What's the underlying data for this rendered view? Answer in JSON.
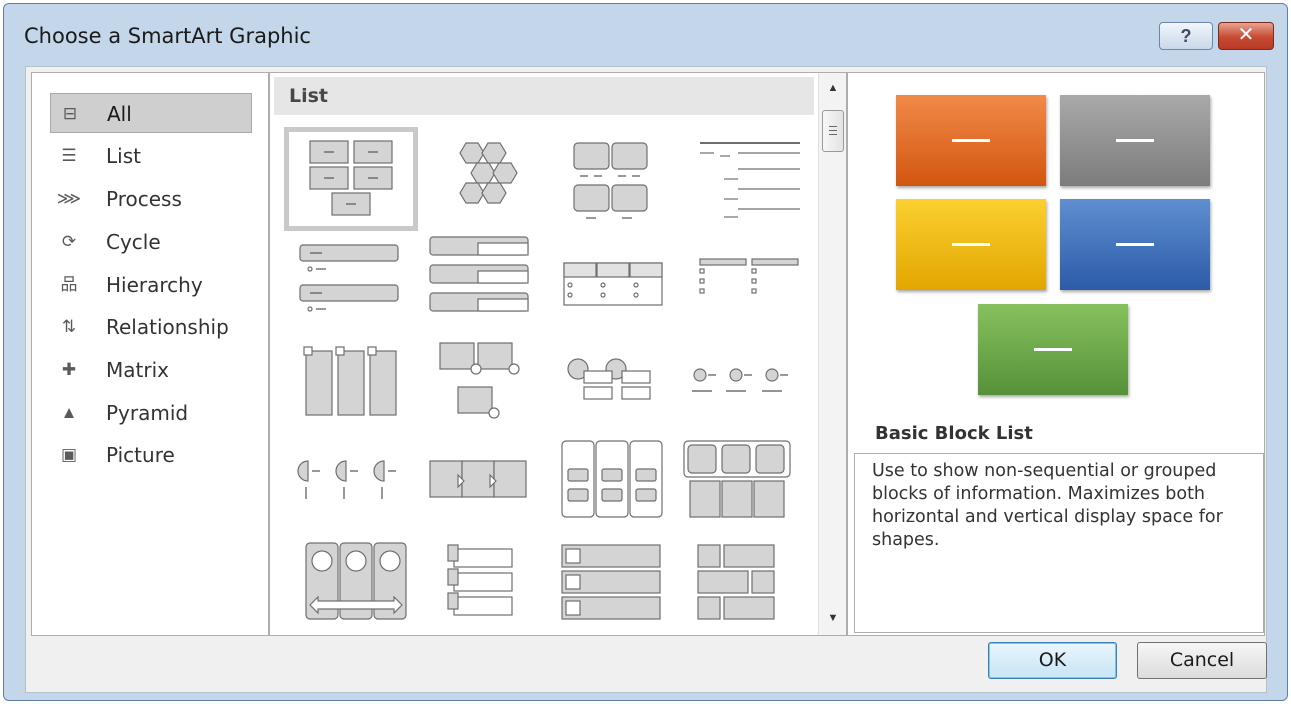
{
  "window": {
    "title": "Choose a SmartArt Graphic",
    "help_label": "?",
    "close_label": "✕"
  },
  "categories": [
    {
      "label": "All",
      "icon": "all-icon",
      "glyph": "⊟",
      "selected": true
    },
    {
      "label": "List",
      "icon": "list-icon",
      "glyph": "☰",
      "selected": false
    },
    {
      "label": "Process",
      "icon": "process-icon",
      "glyph": "⋙",
      "selected": false
    },
    {
      "label": "Cycle",
      "icon": "cycle-icon",
      "glyph": "⟳",
      "selected": false
    },
    {
      "label": "Hierarchy",
      "icon": "hierarchy-icon",
      "glyph": "品",
      "selected": false
    },
    {
      "label": "Relationship",
      "icon": "relationship-icon",
      "glyph": "⇅",
      "selected": false
    },
    {
      "label": "Matrix",
      "icon": "matrix-icon",
      "glyph": "✚",
      "selected": false
    },
    {
      "label": "Pyramid",
      "icon": "pyramid-icon",
      "glyph": "▲",
      "selected": false
    },
    {
      "label": "Picture",
      "icon": "picture-icon",
      "glyph": "▣",
      "selected": false
    }
  ],
  "gallery": {
    "header": "List",
    "selected_layout": "Basic Block List"
  },
  "preview": {
    "title": "Basic Block List",
    "description": "Use to show non-sequential or grouped blocks of information. Maximizes both horizontal and vertical display space for shapes.",
    "placeholder_text": "—",
    "colors": {
      "orange": "#e06a22",
      "gray": "#8f8f8f",
      "yellow": "#f0bb15",
      "blue": "#3b6db7",
      "green": "#6aa84a"
    }
  },
  "buttons": {
    "ok_label": "OK",
    "cancel_label": "Cancel"
  },
  "scrollbar": {
    "up_arrow": "▲",
    "down_arrow": "▼"
  }
}
